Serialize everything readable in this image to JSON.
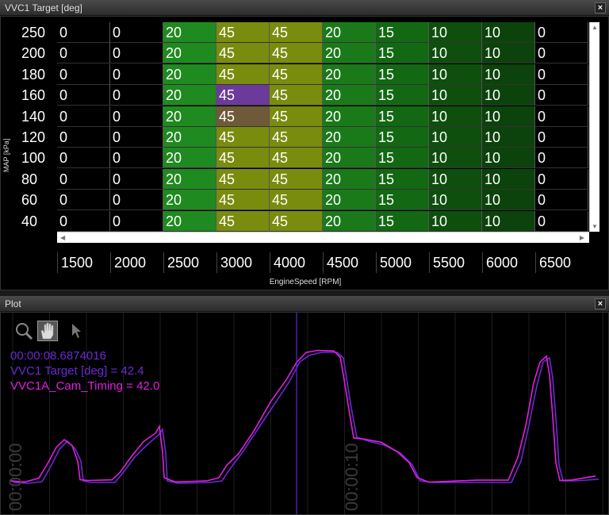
{
  "table_panel": {
    "title": "VVC1 Target [deg]",
    "close_label": "×",
    "y_axis_title": "MAP [kPa]",
    "x_axis_title": "EngineSpeed [RPM]",
    "y_labels": [
      "250",
      "200",
      "180",
      "160",
      "140",
      "120",
      "100",
      "80",
      "60",
      "40"
    ],
    "x_labels": [
      "1500",
      "2000",
      "2500",
      "3000",
      "4000",
      "4500",
      "5000",
      "5500",
      "6000",
      "6500"
    ],
    "rows": [
      [
        "0",
        "0",
        "20",
        "45",
        "45",
        "20",
        "15",
        "10",
        "10",
        "0"
      ],
      [
        "0",
        "0",
        "20",
        "45",
        "45",
        "20",
        "15",
        "10",
        "10",
        "0"
      ],
      [
        "0",
        "0",
        "20",
        "45",
        "45",
        "20",
        "15",
        "10",
        "10",
        "0"
      ],
      [
        "0",
        "0",
        "20",
        "45",
        "45",
        "20",
        "15",
        "10",
        "10",
        "0"
      ],
      [
        "0",
        "0",
        "20",
        "45",
        "45",
        "20",
        "15",
        "10",
        "10",
        "0"
      ],
      [
        "0",
        "0",
        "20",
        "45",
        "45",
        "20",
        "15",
        "10",
        "10",
        "0"
      ],
      [
        "0",
        "0",
        "20",
        "45",
        "45",
        "20",
        "15",
        "10",
        "10",
        "0"
      ],
      [
        "0",
        "0",
        "20",
        "45",
        "45",
        "20",
        "15",
        "10",
        "10",
        "0"
      ],
      [
        "0",
        "0",
        "20",
        "45",
        "45",
        "20",
        "15",
        "10",
        "10",
        "0"
      ],
      [
        "0",
        "0",
        "20",
        "45",
        "45",
        "20",
        "15",
        "10",
        "10",
        "0"
      ]
    ],
    "column_colors": [
      "#000000",
      "#000000",
      "#1f8a1f",
      "#7a8c0e",
      "#7a8c0e",
      "#1a7a1a",
      "#136813",
      "#0e4f0e",
      "#0c420c",
      "#000000"
    ],
    "selected_cell_color": "#6b3a9a",
    "highlight_cell_color": "#6e5a3a"
  },
  "plot_panel": {
    "title": "Plot",
    "close_label": "×",
    "tools": [
      "zoom-icon",
      "pan-hand-icon",
      "pointer-icon"
    ],
    "readout_time": "00:00:08.6874016",
    "readout_series1": "VVC1 Target [deg] = 42.4",
    "readout_series2": "VVC1A_Cam_Timing = 42.0",
    "time_marks": [
      "00:00:00",
      "00:00:10"
    ],
    "series1_color": "#6a2ad0",
    "series2_color": "#e020e0",
    "cursor_color": "#5a2ad8"
  }
}
